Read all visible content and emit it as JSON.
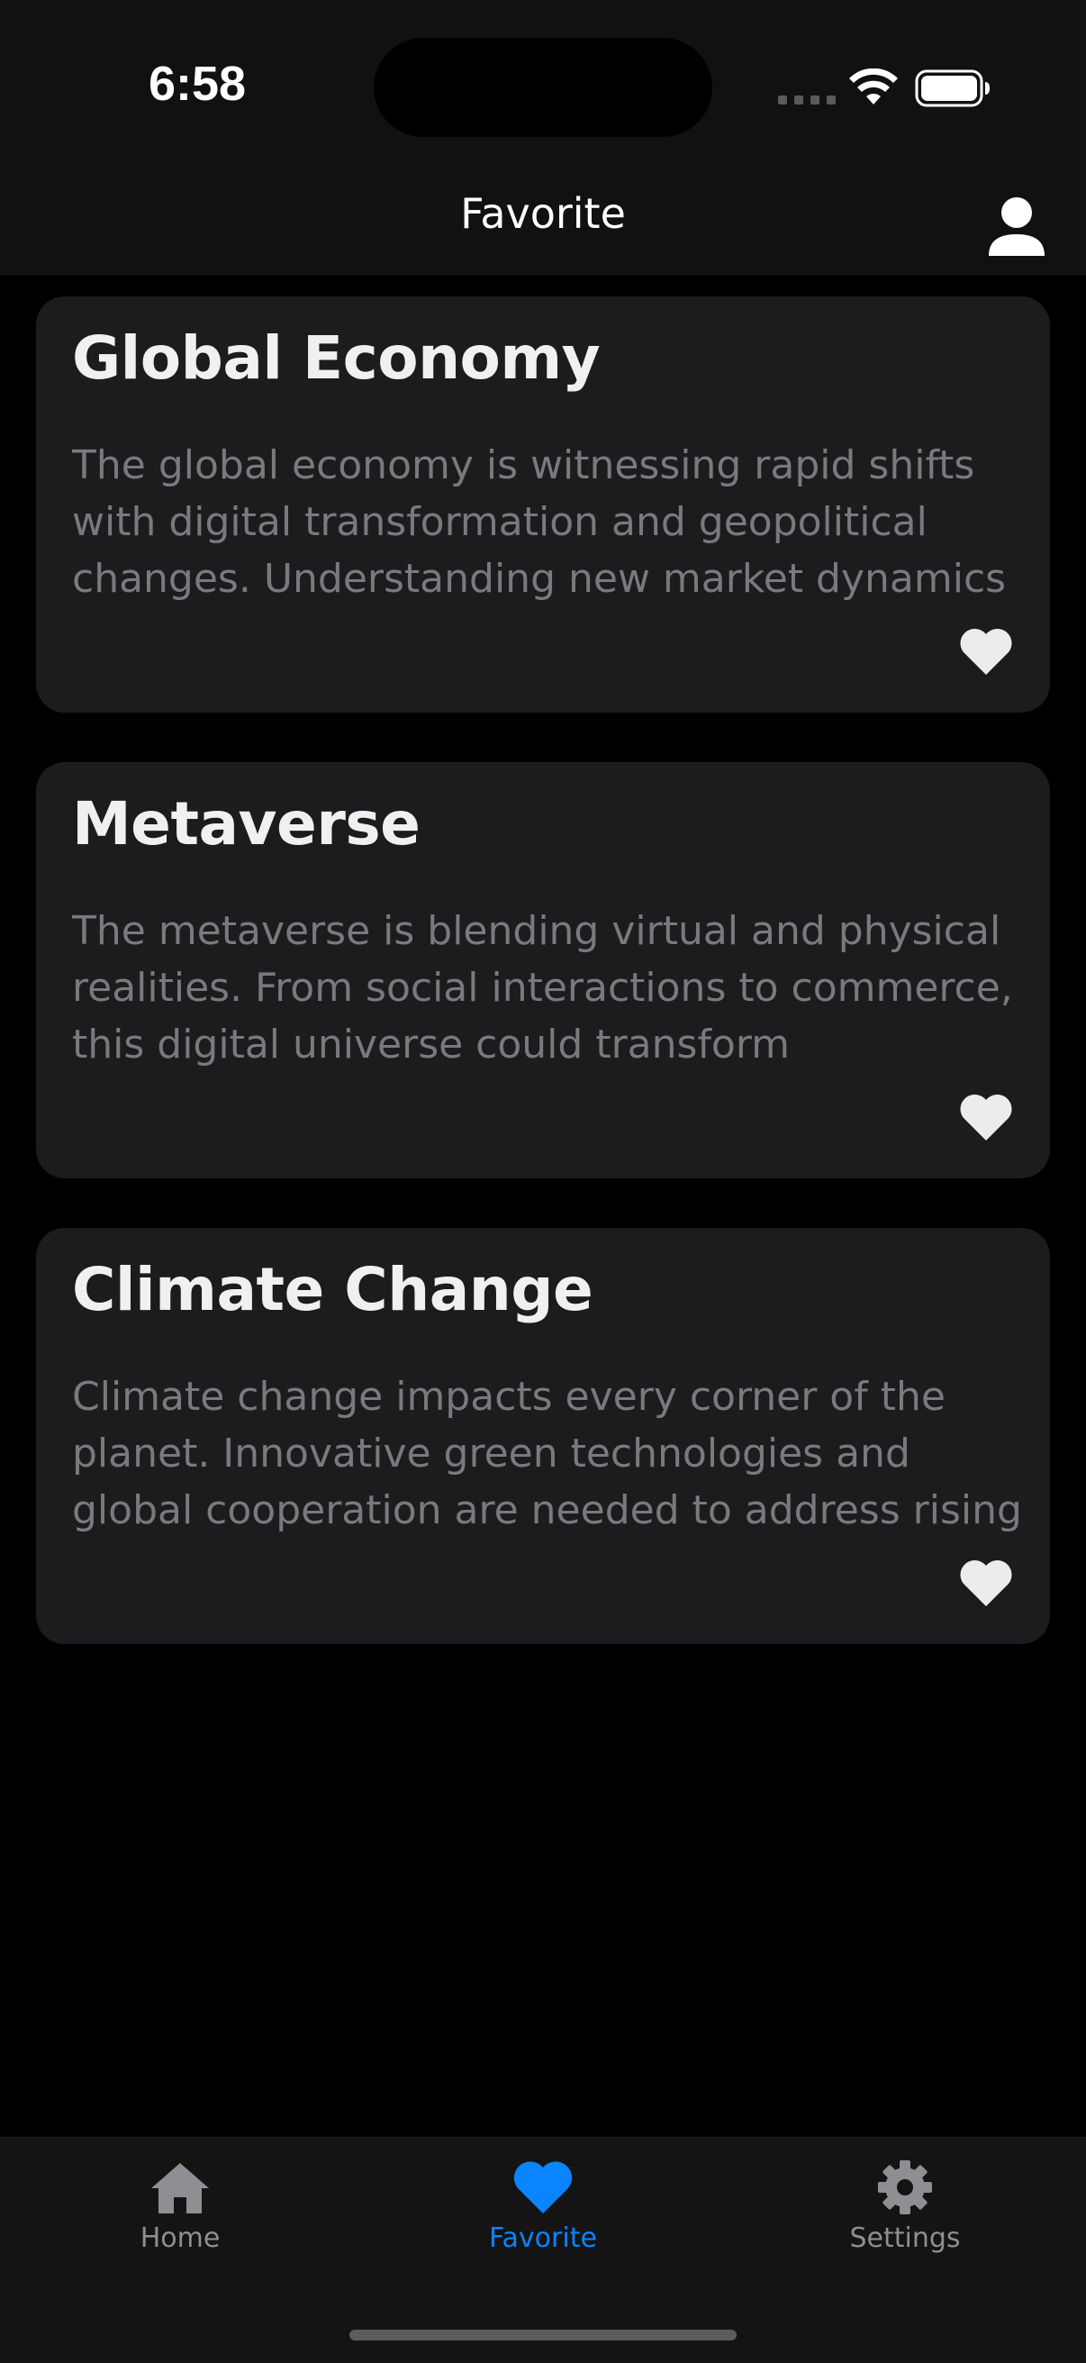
{
  "status_bar": {
    "time": "6:58"
  },
  "nav": {
    "title": "Favorite",
    "profile_icon": "person-icon"
  },
  "cards": [
    {
      "title": "Global Economy",
      "body": "The global economy is witnessing rapid shifts with digital transformation and geopolitical changes. Understanding new market dynamics"
    },
    {
      "title": "Metaverse",
      "body": "The metaverse is blending virtual and physical realities. From social interactions to commerce, this digital universe could transform"
    },
    {
      "title": "Climate Change",
      "body": "Climate change impacts every corner of the planet. Innovative green technologies and global cooperation are needed to address rising"
    }
  ],
  "tabs": [
    {
      "label": "Home",
      "icon": "house-icon",
      "active": false
    },
    {
      "label": "Favorite",
      "icon": "heart-icon",
      "active": true
    },
    {
      "label": "Settings",
      "icon": "gear-icon",
      "active": false
    }
  ],
  "colors": {
    "accent": "#0a84ff",
    "card_background": "#1b1c1e",
    "bar_background": "#111111",
    "inactive_tab": "#8e8e93"
  }
}
